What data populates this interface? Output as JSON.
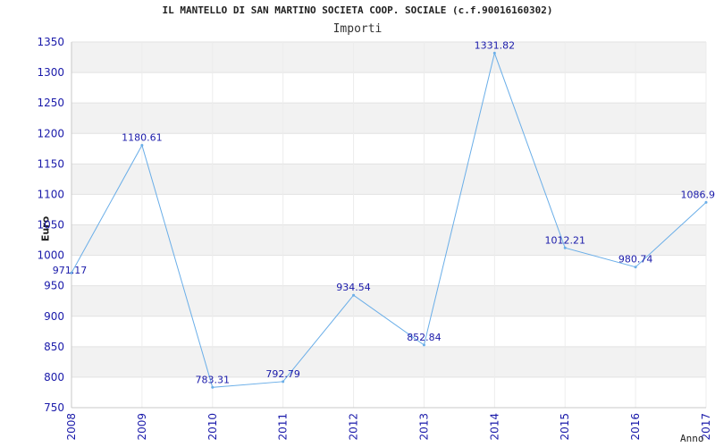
{
  "chart_data": {
    "type": "line",
    "title": "IL MANTELLO DI SAN MARTINO SOCIETA COOP. SOCIALE (c.f.90016160302)",
    "subtitle": "Importi",
    "xlabel": "Anno",
    "ylabel": "Euro",
    "categories": [
      "2008",
      "2009",
      "2010",
      "2011",
      "2012",
      "2013",
      "2014",
      "2015",
      "2016",
      "2017"
    ],
    "series": [
      {
        "values": [
          971.17,
          1180.61,
          783.31,
          792.79,
          934.54,
          852.84,
          1331.82,
          1012.21,
          980.74,
          1086.9
        ],
        "labels": [
          "971.17",
          "1180.61",
          "783.31",
          "792.79",
          "934.54",
          "852.84",
          "1331.82",
          "1012.21",
          "980.74",
          "1086.9"
        ],
        "color": "#6aaee8"
      }
    ],
    "ylim": [
      750,
      1350
    ],
    "yticks": [
      750,
      800,
      850,
      900,
      950,
      1000,
      1050,
      1100,
      1150,
      1200,
      1250,
      1300,
      1350
    ],
    "grid": true,
    "band_color": "#f2f2f2",
    "tick_color": "#1a1aaa"
  }
}
